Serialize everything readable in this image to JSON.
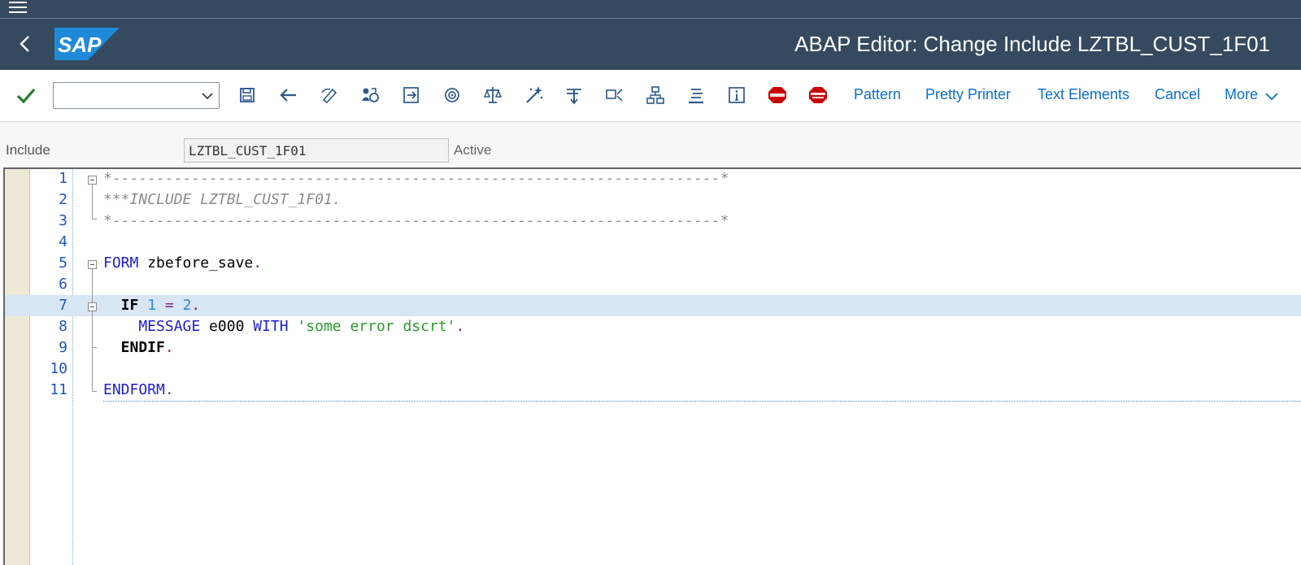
{
  "shell": {
    "title": "ABAP Editor: Change Include LZTBL_CUST_1F01",
    "logo_text": "SAP"
  },
  "toolbar": {
    "command_value": "",
    "icons": [
      "save-icon",
      "back-arrow-icon",
      "display-change-icon",
      "active-inactive-icon",
      "other-object-icon",
      "check-icon",
      "activate-icon",
      "test-icon",
      "where-used-icon",
      "object-list-icon",
      "navigation-window-icon",
      "hierarchy-icon",
      "enhance-icon",
      "info-icon",
      "set-breakpoint-icon",
      "set-session-breakpoint-icon"
    ],
    "pattern_label": "Pattern",
    "pretty_printer_label": "Pretty Printer",
    "text_elements_label": "Text Elements",
    "cancel_label": "Cancel",
    "more_label": "More"
  },
  "include": {
    "label": "Include",
    "value": "LZTBL_CUST_1F01",
    "status": "Active"
  },
  "editor": {
    "current_line": 7,
    "lines": [
      {
        "num": "1",
        "tokens": [
          {
            "t": "*---------------------------------------------------------------------*",
            "c": "c-comment"
          }
        ]
      },
      {
        "num": "2",
        "tokens": [
          {
            "t": "***INCLUDE LZTBL_CUST_1F01.",
            "c": "c-comment"
          }
        ]
      },
      {
        "num": "3",
        "tokens": [
          {
            "t": "*---------------------------------------------------------------------*",
            "c": "c-comment"
          }
        ]
      },
      {
        "num": "4",
        "tokens": []
      },
      {
        "num": "5",
        "tokens": [
          {
            "t": "FORM",
            "c": "c-kw"
          },
          {
            "t": " zbefore_save",
            "c": "c-id"
          },
          {
            "t": ".",
            "c": "c-punct"
          }
        ]
      },
      {
        "num": "6",
        "tokens": []
      },
      {
        "num": "7",
        "tokens": [
          {
            "t": "  IF",
            "c": "c-kwb"
          },
          {
            "t": " 1",
            "c": "c-num"
          },
          {
            "t": " =",
            "c": "c-punct"
          },
          {
            "t": " 2",
            "c": "c-num"
          },
          {
            "t": ".",
            "c": "c-punct"
          }
        ]
      },
      {
        "num": "8",
        "tokens": [
          {
            "t": "    MESSAGE",
            "c": "c-kw"
          },
          {
            "t": " e000",
            "c": "c-id"
          },
          {
            "t": " WITH",
            "c": "c-kw"
          },
          {
            "t": " 'some error dscrt'",
            "c": "c-str"
          },
          {
            "t": ".",
            "c": "c-punct"
          }
        ]
      },
      {
        "num": "9",
        "tokens": [
          {
            "t": "  ENDIF",
            "c": "c-kwb"
          },
          {
            "t": ".",
            "c": "c-punct"
          }
        ]
      },
      {
        "num": "10",
        "tokens": []
      },
      {
        "num": "11",
        "tokens": [
          {
            "t": "ENDFORM",
            "c": "c-kw"
          },
          {
            "t": ".",
            "c": "c-punct"
          }
        ]
      }
    ]
  },
  "colors": {
    "shell_bg": "#354a5f",
    "link": "#0a6ed1",
    "current_line": "#d8e5f2",
    "check_green": "#2b7c2b",
    "breakpoint_red": "#cc0000"
  }
}
